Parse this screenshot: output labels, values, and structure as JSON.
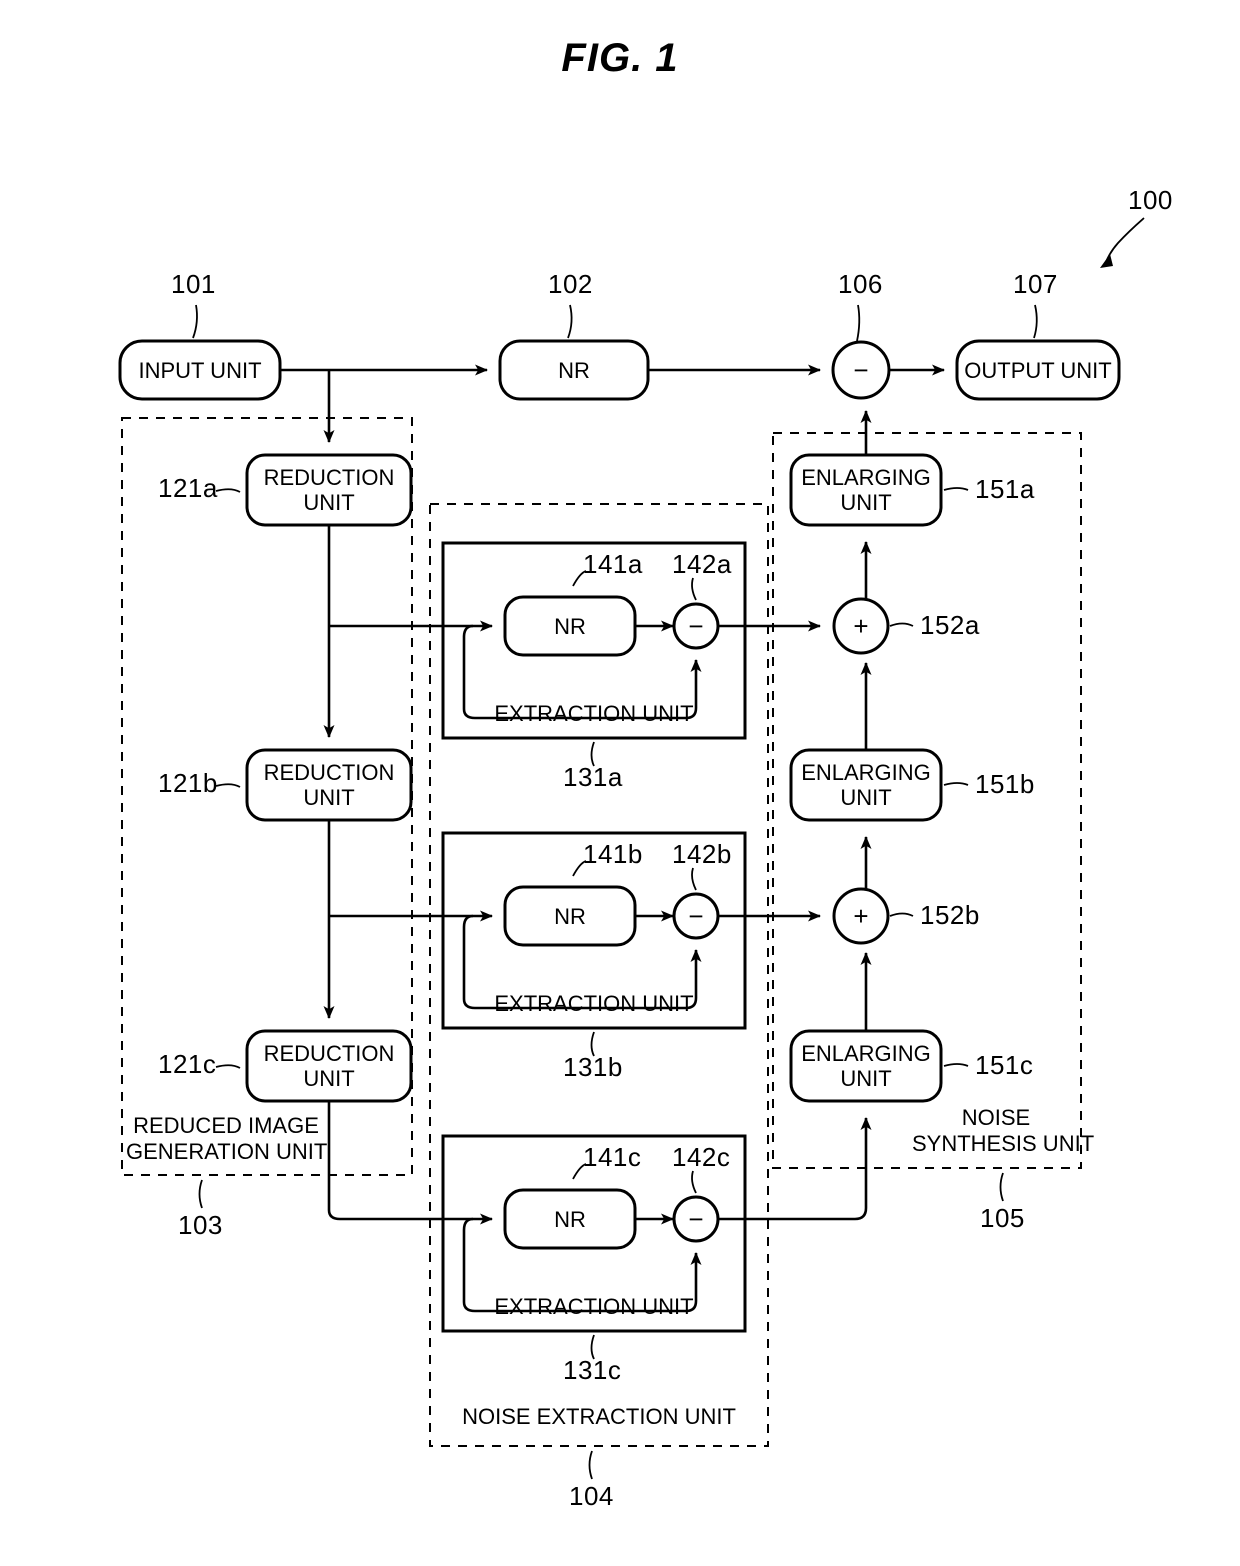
{
  "figure": {
    "title": "FIG. 1",
    "system_ref": "100"
  },
  "blocks": {
    "input_unit": {
      "label": "INPUT UNIT",
      "ref": "101"
    },
    "nr_main": {
      "label": "NR",
      "ref": "102"
    },
    "subtract_main": {
      "symbol": "−",
      "ref": "106"
    },
    "output_unit": {
      "label": "OUTPUT UNIT",
      "ref": "107"
    },
    "reduction_a": {
      "label": "REDUCTION\nUNIT",
      "ref": "121a"
    },
    "reduction_b": {
      "label": "REDUCTION\nUNIT",
      "ref": "121b"
    },
    "reduction_c": {
      "label": "REDUCTION\nUNIT",
      "ref": "121c"
    },
    "nr_a": {
      "label": "NR",
      "ref": "141a"
    },
    "nr_b": {
      "label": "NR",
      "ref": "141b"
    },
    "nr_c": {
      "label": "NR",
      "ref": "141c"
    },
    "sub_a": {
      "symbol": "−",
      "ref": "142a"
    },
    "sub_b": {
      "symbol": "−",
      "ref": "142b"
    },
    "sub_c": {
      "symbol": "−",
      "ref": "142c"
    },
    "extraction_a": {
      "label": "EXTRACTION UNIT",
      "ref": "131a"
    },
    "extraction_b": {
      "label": "EXTRACTION UNIT",
      "ref": "131b"
    },
    "extraction_c": {
      "label": "EXTRACTION UNIT",
      "ref": "131c"
    },
    "enlarging_a": {
      "label": "ENLARGING\nUNIT",
      "ref": "151a"
    },
    "enlarging_b": {
      "label": "ENLARGING\nUNIT",
      "ref": "151b"
    },
    "enlarging_c": {
      "label": "ENLARGING\nUNIT",
      "ref": "151c"
    },
    "add_a": {
      "symbol": "+",
      "ref": "152a"
    },
    "add_b": {
      "symbol": "+",
      "ref": "152b"
    }
  },
  "groups": {
    "reduced_image_generation_unit": {
      "label": "REDUCED IMAGE\nGENERATION UNIT",
      "ref": "103"
    },
    "noise_extraction_unit": {
      "label": "NOISE EXTRACTION UNIT",
      "ref": "104"
    },
    "noise_synthesis_unit": {
      "label": "NOISE\nSYNTHESIS UNIT",
      "ref": "105"
    }
  },
  "colors": {
    "line": "#000000",
    "background": "#ffffff"
  }
}
